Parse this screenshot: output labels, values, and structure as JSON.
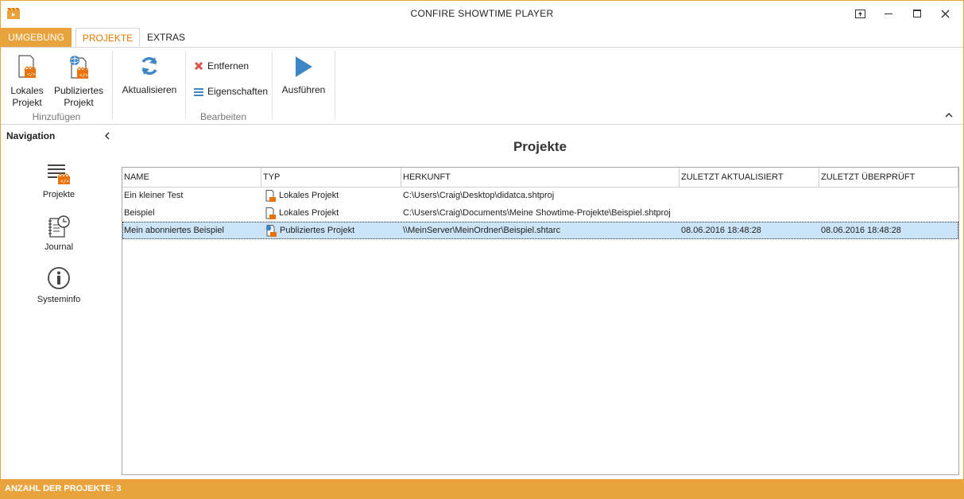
{
  "window": {
    "title": "CONFIRE SHOWTIME PLAYER"
  },
  "tabs": [
    {
      "label": "UMGEBUNG"
    },
    {
      "label": "PROJEKTE"
    },
    {
      "label": "EXTRAS"
    }
  ],
  "ribbon": {
    "lokales_projekt": "Lokales\nProjekt",
    "publiziertes_projekt": "Publiziertes\nProjekt",
    "group_hinzufuegen": "Hinzufügen",
    "aktualisieren": "Aktualisieren",
    "entfernen": "Entfernen",
    "eigenschaften": "Eigenschaften",
    "ausfuehren": "Ausführen",
    "group_bearbeiten": "Bearbeiten"
  },
  "navigation": {
    "title": "Navigation",
    "items": [
      {
        "label": "Projekte"
      },
      {
        "label": "Journal"
      },
      {
        "label": "Systeminfo"
      }
    ]
  },
  "main": {
    "title": "Projekte",
    "columns": [
      "NAME",
      "TYP",
      "HERKUNFT",
      "ZULETZT AKTUALISIERT",
      "ZULETZT ÜBERPRÜFT"
    ],
    "rows": [
      {
        "name": "Ein kleiner Test",
        "typ": "Lokales Projekt",
        "herkunft": "C:\\Users\\Craig\\Desktop\\didatca.shtproj",
        "aktualisiert": "",
        "geprueft": ""
      },
      {
        "name": "Beispiel",
        "typ": "Lokales Projekt",
        "herkunft": "C:\\Users\\Craig\\Documents\\Meine Showtime-Projekte\\Beispiel.shtproj",
        "aktualisiert": "",
        "geprueft": ""
      },
      {
        "name": "Mein abonniertes Beispiel",
        "typ": "Publiziertes Projekt",
        "herkunft": "\\\\MeinServer\\MeinOrdner\\Beispiel.shtarc",
        "aktualisiert": "08.06.2016 18:48:28",
        "geprueft": "08.06.2016 18:48:28"
      }
    ]
  },
  "statusbar": {
    "text": "ANZAHL DER PROJEKTE: 3"
  },
  "colors": {
    "accent": "#e8a33d",
    "tab_active": "#e07b00",
    "selection": "#cce4f7",
    "icon_blue": "#3e86c6",
    "remove_red": "#d9534f"
  }
}
